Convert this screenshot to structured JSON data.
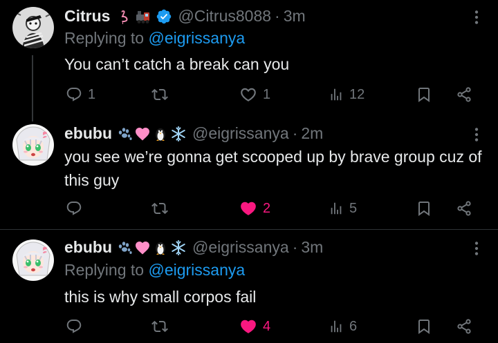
{
  "colors": {
    "background": "#000000",
    "text": "#e7e9ea",
    "muted": "#71767b",
    "link": "#1d9bf0",
    "like": "#f91880",
    "divider": "#2f3336"
  },
  "tweets": [
    {
      "name": "Citrus",
      "badges": [
        "flamingo-emoji",
        "locomotive-emoji",
        "verified-badge"
      ],
      "handle": "@Citrus8088",
      "time": "3m",
      "replying_label": "Replying to",
      "replying_to": "@eigrissanya",
      "text": "You can’t catch a break can you",
      "replies": "1",
      "retweets": "",
      "likes": "1",
      "liked": false,
      "views": "12"
    },
    {
      "name": "ebubu",
      "badges": [
        "paw-prints-emoji",
        "pink-heart-emoji",
        "penguin-emoji",
        "snowflake-emoji"
      ],
      "handle": "@eigrissanya",
      "time": "2m",
      "text": "you see we’re gonna get scooped up by brave group cuz of this guy",
      "replies": "",
      "retweets": "",
      "likes": "2",
      "liked": true,
      "views": "5"
    },
    {
      "name": "ebubu",
      "badges": [
        "paw-prints-emoji",
        "pink-heart-emoji",
        "penguin-emoji",
        "snowflake-emoji"
      ],
      "handle": "@eigrissanya",
      "time": "3m",
      "replying_label": "Replying to",
      "replying_to": "@eigrissanya",
      "text": "this is why small corpos fail",
      "replies": "",
      "retweets": "",
      "likes": "4",
      "liked": true,
      "views": "6"
    }
  ]
}
